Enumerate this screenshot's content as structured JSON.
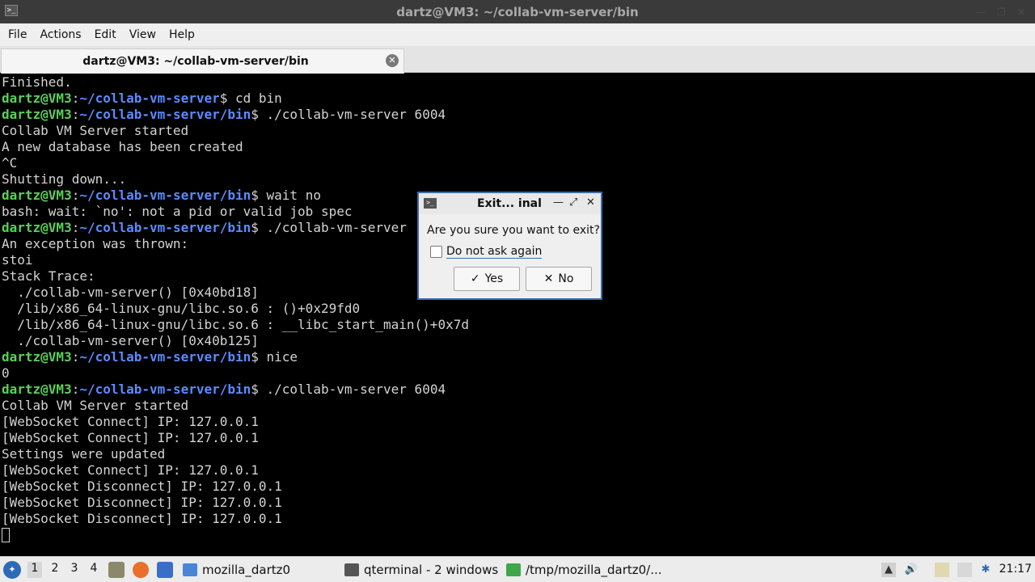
{
  "window": {
    "title": "dartz@VM3: ~/collab-vm-server/bin",
    "controls": [
      "minimize-icon",
      "maximize-icon",
      "close-icon"
    ]
  },
  "menubar": {
    "items": [
      "File",
      "Actions",
      "Edit",
      "View",
      "Help"
    ]
  },
  "tab": {
    "label": "dartz@VM3: ~/collab-vm-server/bin",
    "close_glyph": "✕"
  },
  "terminal": {
    "lines": [
      {
        "text": "Finished."
      },
      {
        "user": "dartz@VM3",
        "path": "~/collab-vm-server",
        "cmd": "$ cd bin"
      },
      {
        "user": "dartz@VM3",
        "path": "~/collab-vm-server/bin",
        "cmd": "$ ./collab-vm-server 6004"
      },
      {
        "text": "Collab VM Server started"
      },
      {
        "text": "A new database has been created"
      },
      {
        "text": "^C"
      },
      {
        "text": "Shutting down..."
      },
      {
        "user": "dartz@VM3",
        "path": "~/collab-vm-server/bin",
        "cmd": "$ wait no"
      },
      {
        "text": "bash: wait: `no': not a pid or valid job spec"
      },
      {
        "user": "dartz@VM3",
        "path": "~/collab-vm-server/bin",
        "cmd": "$ ./collab-vm-server"
      },
      {
        "text": "An exception was thrown:"
      },
      {
        "text": "stoi"
      },
      {
        "text": "Stack Trace:"
      },
      {
        "text": "  ./collab-vm-server() [0x40bd18]"
      },
      {
        "text": "  /lib/x86_64-linux-gnu/libc.so.6 : ()+0x29fd0"
      },
      {
        "text": "  /lib/x86_64-linux-gnu/libc.so.6 : __libc_start_main()+0x7d"
      },
      {
        "text": "  ./collab-vm-server() [0x40b125]"
      },
      {
        "user": "dartz@VM3",
        "path": "~/collab-vm-server/bin",
        "cmd": "$ nice"
      },
      {
        "text": "0"
      },
      {
        "user": "dartz@VM3",
        "path": "~/collab-vm-server/bin",
        "cmd": "$ ./collab-vm-server 6004"
      },
      {
        "text": "Collab VM Server started"
      },
      {
        "text": "[WebSocket Connect] IP: 127.0.0.1"
      },
      {
        "text": "[WebSocket Connect] IP: 127.0.0.1"
      },
      {
        "text": "Settings were updated"
      },
      {
        "text": "[WebSocket Connect] IP: 127.0.0.1"
      },
      {
        "text": "[WebSocket Disconnect] IP: 127.0.0.1"
      },
      {
        "text": "[WebSocket Disconnect] IP: 127.0.0.1"
      },
      {
        "text": "[WebSocket Disconnect] IP: 127.0.0.1"
      }
    ]
  },
  "dialog": {
    "title": "Exit... inal",
    "question": "Are you sure you want to exit?",
    "checkbox_label": "Do not ask again",
    "checkbox_checked": false,
    "yes_label": "Yes",
    "no_label": "No"
  },
  "taskbar": {
    "workspaces": [
      "1",
      "2",
      "3",
      "4"
    ],
    "active_workspace": "1",
    "launchers": [
      "file-manager-icon",
      "firefox-icon",
      "desktop-icon"
    ],
    "tasks": [
      {
        "label": "mozilla_dartz0",
        "icon": "folder-icon"
      },
      {
        "label": "qterminal - 2 windows",
        "icon": "terminal-icon"
      },
      {
        "label": "/tmp/mozilla_dartz0/...",
        "icon": "archive-icon"
      }
    ],
    "tray": [
      "tray-arrow-icon",
      "volume-icon",
      "clipboard-icon",
      "network-icon",
      "bluetooth-icon"
    ],
    "clock": "21:17"
  },
  "colors": {
    "prompt_user": "#5ad05a",
    "prompt_path": "#5a8bff",
    "terminal_bg": "#000000",
    "terminal_fg": "#d3d3d3"
  }
}
